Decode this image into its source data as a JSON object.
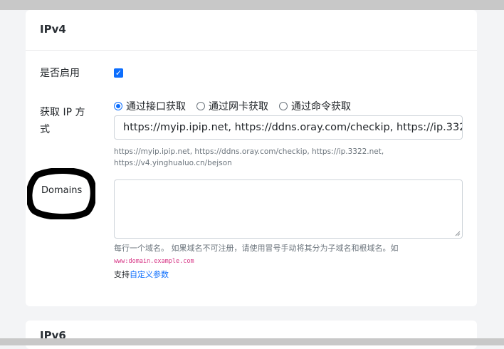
{
  "ipv4": {
    "title": "IPv4",
    "enable_label": "是否启用",
    "enable_checked": true,
    "method_label": "获取 IP 方式",
    "methods": [
      {
        "label": "通过接口获取",
        "checked": true
      },
      {
        "label": "通过网卡获取",
        "checked": false
      },
      {
        "label": "通过命令获取",
        "checked": false
      }
    ],
    "url_value": "https://myip.ipip.net, https://ddns.oray.com/checkip, https://ip.3322.net, https://v4.yinghualuo.cn/bejson",
    "url_hint": "https://myip.ipip.net, https://ddns.oray.com/checkip, https://ip.3322.net, https://v4.yinghualuo.cn/bejson",
    "domains_label": "Domains",
    "domains_value": "",
    "domains_hint": "每行一个域名。 如果域名不可注册，请使用冒号手动将其分为子域名和根域名。如",
    "domains_example": "www:domain.example.com",
    "support_prefix": "支持",
    "support_link": "自定义参数"
  },
  "ipv6": {
    "title": "IPv6"
  },
  "colors": {
    "accent": "#0d6efd",
    "annotation": "#000000",
    "code": "#d63384"
  }
}
